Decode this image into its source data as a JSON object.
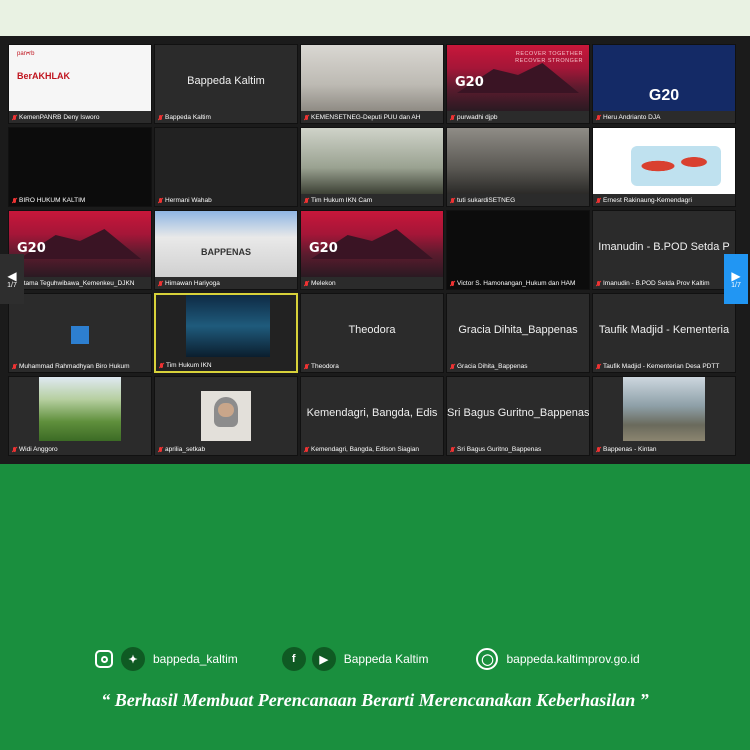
{
  "meeting": {
    "page_indicator_left": "1/7",
    "page_indicator_right": "1/7",
    "tiles": [
      {
        "name": "KemenPANRB Deny Isworo",
        "kind": "slide",
        "slide_logo": "pan•rb",
        "slide_title": "BerAKHLAK"
      },
      {
        "name": "Bappeda Kaltim",
        "kind": "name",
        "center": "Bappeda Kaltim"
      },
      {
        "name": "KEMENSETNEG-Deputi PUU dan AH",
        "kind": "room"
      },
      {
        "name": "purwadhi djpb",
        "kind": "g20red",
        "top_text": "RECOVER TOGETHER\nRECOVER STRONGER",
        "g20": "G20"
      },
      {
        "name": "Heru Andrianto DJA",
        "kind": "g20blue",
        "g20": "G20"
      },
      {
        "name": "BIRO HUKUM KALTIM",
        "kind": "black"
      },
      {
        "name": "Hermani Wahab",
        "kind": "dark"
      },
      {
        "name": "Tim Hukum IKN Cam",
        "kind": "room-green"
      },
      {
        "name": "tuti sukardiSETNEG",
        "kind": "room-dark"
      },
      {
        "name": "Ernest Rakinaung-Kemendagri",
        "kind": "map"
      },
      {
        "name": "Utama Teguhwibawa_Kemenkeu_DJKN",
        "kind": "g20red",
        "top_text": "",
        "g20": "G20"
      },
      {
        "name": "Himawan Hariyoga",
        "kind": "building",
        "building_text": "BAPPENAS"
      },
      {
        "name": "Melekon",
        "kind": "g20red",
        "top_text": "",
        "g20": "G20"
      },
      {
        "name": "Victor S. Hamonangan_Hukum dan HAM",
        "kind": "black"
      },
      {
        "name": "Imanudin - B.POD Setda Prov Kaltim",
        "kind": "name",
        "center": "Imanudin - B.POD Setda P"
      },
      {
        "name": "Muhammad Rahmadhyan Biro Hukum",
        "kind": "bluesq"
      },
      {
        "name": "Tim Hukum IKN",
        "kind": "sea",
        "active": true
      },
      {
        "name": "Theodora",
        "kind": "name",
        "center": "Theodora"
      },
      {
        "name": "Gracia Dihita_Bappenas",
        "kind": "name",
        "center": "Gracia Dihita_Bappenas"
      },
      {
        "name": "Taufik Madjid - Kementerian Desa PDTT",
        "kind": "name",
        "center": "Taufik Madjid - Kementeria"
      },
      {
        "name": "Widi Anggoro",
        "kind": "field"
      },
      {
        "name": "aprilia_setkab",
        "kind": "portrait"
      },
      {
        "name": "Kemendagri, Bangda, Edison Siagian",
        "kind": "name",
        "center": "Kemendagri, Bangda, Edis"
      },
      {
        "name": "Sri Bagus Guritno_Bappenas",
        "kind": "name",
        "center": "Sri Bagus Guritno_Bappenas"
      },
      {
        "name": "Bappenas - Kintan",
        "kind": "beach"
      }
    ]
  },
  "footer": {
    "instagram_twitter_handle": "bappeda_kaltim",
    "facebook_youtube_handle": "Bappeda Kaltim",
    "website": "bappeda.kaltimprov.go.id",
    "tagline": "“ Berhasil  Membuat Perencanaan Berarti Merencanakan Keberhasilan ”",
    "icons": [
      "instagram-icon",
      "twitter-icon",
      "facebook-icon",
      "youtube-icon",
      "globe-icon"
    ],
    "colors": {
      "background": "#1a8f3e",
      "top_band": "#e9f2e3",
      "meeting_bg": "#1b1b1b",
      "active_border": "#d8d23a"
    }
  }
}
